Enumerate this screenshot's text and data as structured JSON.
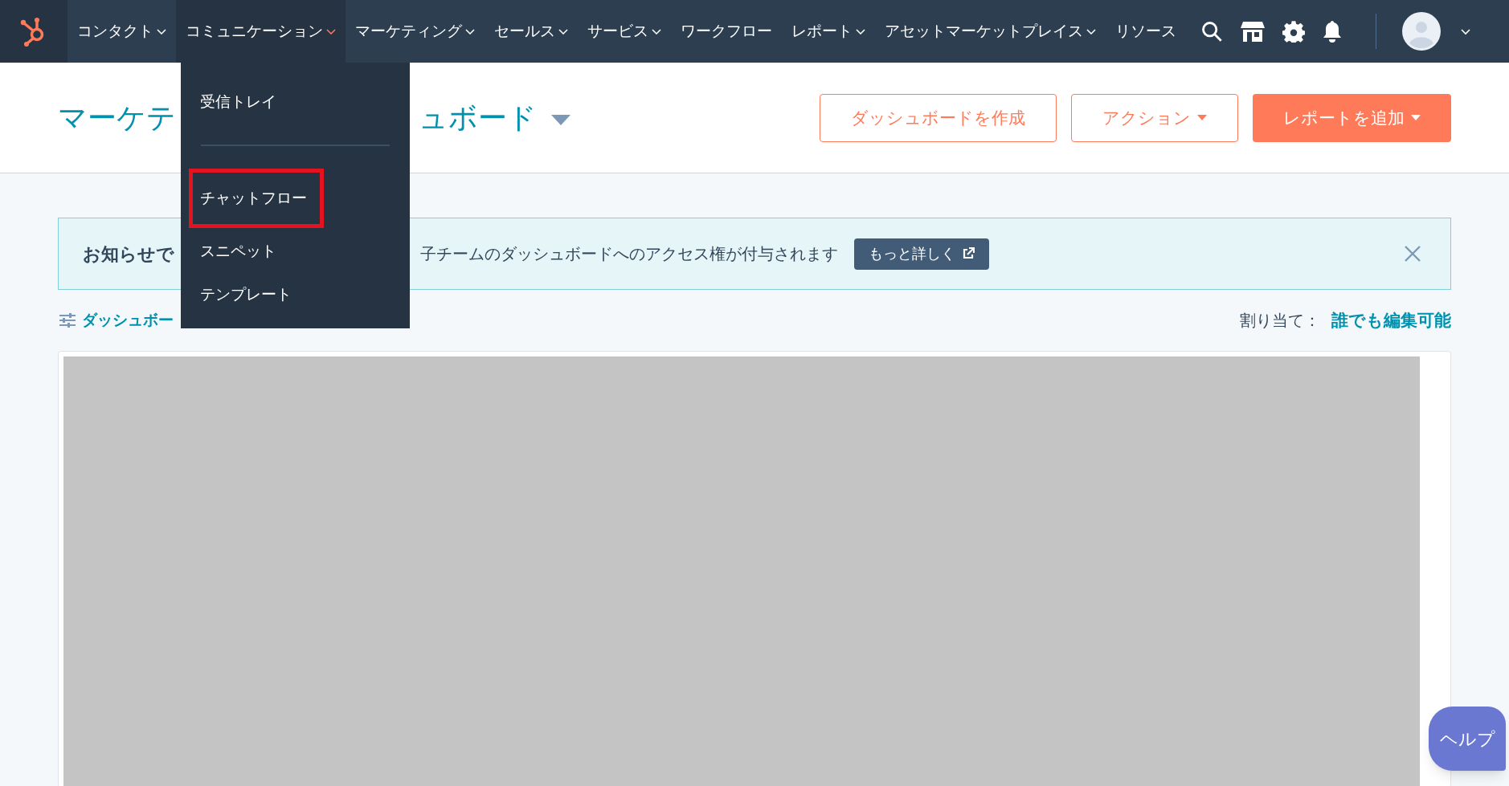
{
  "nav": {
    "items": [
      {
        "label": "コンタクト",
        "has_menu": true,
        "selected": false
      },
      {
        "label": "コミュニケーション",
        "has_menu": true,
        "selected": true
      },
      {
        "label": "マーケティング",
        "has_menu": true,
        "selected": false
      },
      {
        "label": "セールス",
        "has_menu": true,
        "selected": false
      },
      {
        "label": "サービス",
        "has_menu": true,
        "selected": false
      },
      {
        "label": "ワークフロー",
        "has_menu": false,
        "selected": false
      },
      {
        "label": "レポート",
        "has_menu": true,
        "selected": false
      },
      {
        "label": "アセットマーケットプレイス",
        "has_menu": true,
        "selected": false
      },
      {
        "label": "リソース",
        "has_menu": false,
        "selected": false
      }
    ]
  },
  "dropdown": {
    "items": [
      {
        "kind": "link",
        "label": "受信トレイ",
        "highlighted": false
      },
      {
        "kind": "divider"
      },
      {
        "kind": "link",
        "label": "チャットフロー",
        "highlighted": true
      },
      {
        "kind": "link",
        "label": "スニペット",
        "highlighted": false
      },
      {
        "kind": "link",
        "label": "テンプレート",
        "highlighted": false
      }
    ]
  },
  "header": {
    "title_parts": [
      "マーケテ",
      "ュボード"
    ],
    "buttons": [
      {
        "label": "ダッシュボードを作成",
        "kind": "outline",
        "has_menu": false
      },
      {
        "label": "アクション",
        "kind": "outline",
        "has_menu": true
      },
      {
        "label": "レポートを追加",
        "kind": "primary",
        "has_menu": true
      }
    ]
  },
  "banner": {
    "text_parts": [
      "お知らせで",
      "子チームのダッシュボードへのアクセス権が付与されます"
    ],
    "button": "もっと詳しく"
  },
  "filter": {
    "link": "ダッシュボー",
    "assign_label": "割り当て：",
    "assign_value": "誰でも編集可能"
  },
  "help": "ヘルプ"
}
